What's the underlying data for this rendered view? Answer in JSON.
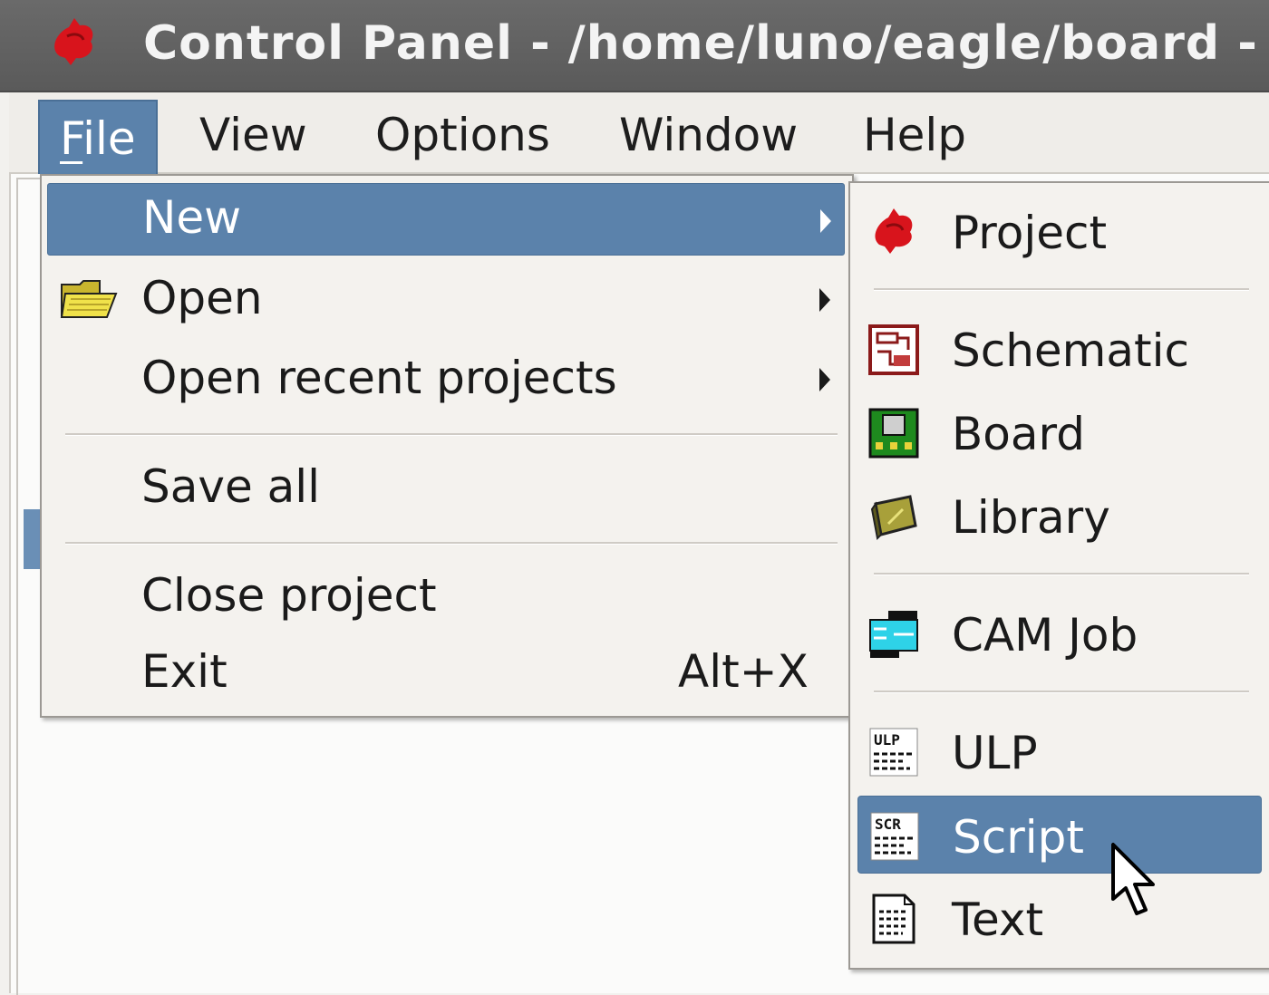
{
  "window": {
    "title": "Control Panel - /home/luno/eagle/board -",
    "app_icon": "eagle-icon"
  },
  "menubar": {
    "file": "File",
    "view": "View",
    "options": "Options",
    "window": "Window",
    "help": "Help"
  },
  "file_menu": {
    "new": "New",
    "open": "Open",
    "open_recent": "Open recent projects",
    "save_all": "Save all",
    "close_project": "Close project",
    "exit": "Exit",
    "exit_shortcut": "Alt+X",
    "open_icon": "folder-icon"
  },
  "new_submenu": {
    "project": "Project",
    "schematic": "Schematic",
    "board": "Board",
    "library": "Library",
    "cam_job": "CAM Job",
    "ulp": "ULP",
    "script": "Script",
    "text": "Text",
    "highlighted": "Script",
    "icons": [
      "eagle-icon",
      "schematic-icon",
      "board-icon",
      "library-icon",
      "cam-job-icon",
      "ulp-icon",
      "script-icon",
      "text-file-icon"
    ]
  },
  "colors": {
    "selection": "#5b82ab",
    "titlebar": "#5f5f5f",
    "menu_bg": "#f4f2ee",
    "eagle_red": "#d8141c"
  }
}
